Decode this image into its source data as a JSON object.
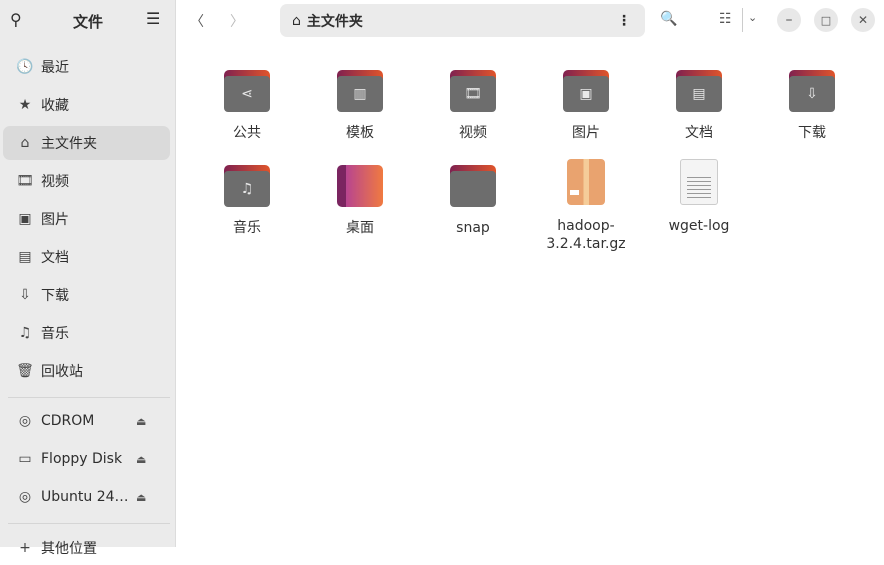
{
  "sidebar": {
    "title": "文件",
    "places": [
      {
        "icon": "clock-icon",
        "glyph": "🕓",
        "label": "最近"
      },
      {
        "icon": "star-icon",
        "glyph": "★",
        "label": "收藏"
      },
      {
        "icon": "home-icon",
        "glyph": "⌂",
        "label": "主文件夹",
        "active": true
      },
      {
        "icon": "video-icon",
        "glyph": "🎞",
        "label": "视频"
      },
      {
        "icon": "image-icon",
        "glyph": "▣",
        "label": "图片"
      },
      {
        "icon": "document-icon",
        "glyph": "▤",
        "label": "文档"
      },
      {
        "icon": "download-icon",
        "glyph": "⇩",
        "label": "下载"
      },
      {
        "icon": "music-icon",
        "glyph": "♫",
        "label": "音乐"
      },
      {
        "icon": "trash-icon",
        "glyph": "🗑",
        "label": "回收站"
      }
    ],
    "devices": [
      {
        "icon": "disc-icon",
        "glyph": "◎",
        "label": "CDROM"
      },
      {
        "icon": "floppy-icon",
        "glyph": "▭",
        "label": "Floppy Disk"
      },
      {
        "icon": "disc-icon",
        "glyph": "◎",
        "label": "Ubuntu 24…"
      }
    ],
    "other": {
      "label": "其他位置"
    }
  },
  "header": {
    "path": "主文件夹"
  },
  "files": [
    {
      "label": "公共",
      "type": "folder",
      "glyph": "⋖"
    },
    {
      "label": "模板",
      "type": "folder",
      "glyph": "▥"
    },
    {
      "label": "视频",
      "type": "folder",
      "glyph": "🎞"
    },
    {
      "label": "图片",
      "type": "folder",
      "glyph": "▣"
    },
    {
      "label": "文档",
      "type": "folder",
      "glyph": "▤"
    },
    {
      "label": "下载",
      "type": "folder",
      "glyph": "⇩"
    },
    {
      "label": "音乐",
      "type": "folder",
      "glyph": "♫"
    },
    {
      "label": "桌面",
      "type": "desktop"
    },
    {
      "label": "snap",
      "type": "folder",
      "glyph": ""
    },
    {
      "label": "hadoop-3.2.4.tar.gz",
      "type": "archive"
    },
    {
      "label": "wget-log",
      "type": "text"
    }
  ]
}
